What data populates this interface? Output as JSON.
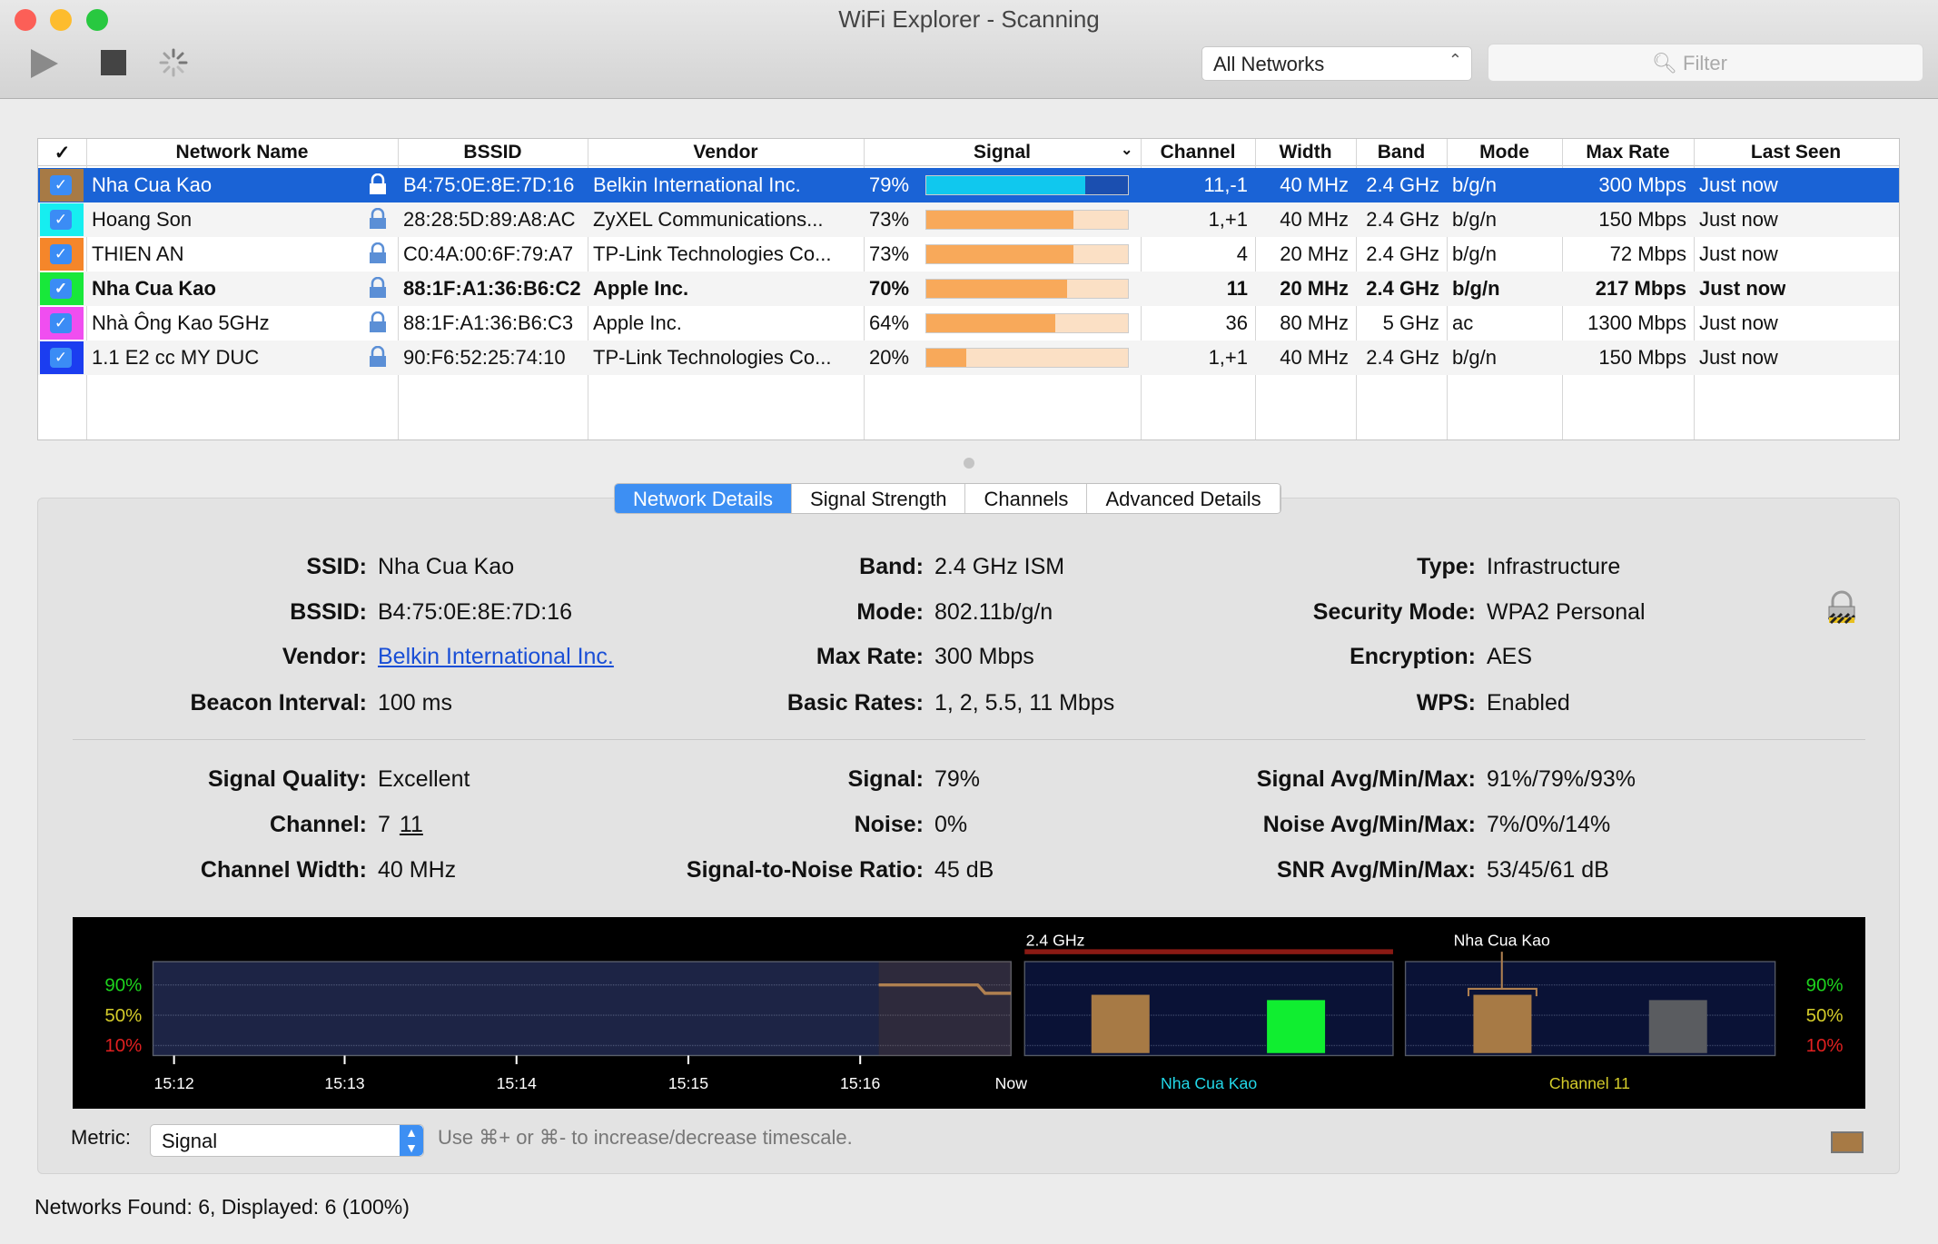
{
  "window": {
    "title": "WiFi Explorer - Scanning"
  },
  "toolbar": {
    "play": "play-icon",
    "stop": "stop-icon",
    "spinner": "spinner-icon",
    "network_filter": "All Networks",
    "filter_placeholder": "Filter"
  },
  "table": {
    "columns": [
      "✓",
      "Network Name",
      "BSSID",
      "Vendor",
      "Signal",
      "Channel",
      "Width",
      "Band",
      "Mode",
      "Max Rate",
      "Last Seen"
    ],
    "sort_column": "Signal",
    "rows": [
      {
        "color": "#a77a45",
        "checked": true,
        "name": "Nha Cua Kao",
        "bssid": "B4:75:0E:8E:7D:16",
        "vendor": "Belkin International Inc.",
        "signal": 79,
        "channel": "11,-1",
        "width": "40 MHz",
        "band": "2.4 GHz",
        "mode": "b/g/n",
        "max_rate": "300 Mbps",
        "last_seen": "Just now",
        "selected": true,
        "bold": false
      },
      {
        "color": "#16eef0",
        "checked": true,
        "name": "Hoang Son",
        "bssid": "28:28:5D:89:A8:AC",
        "vendor": "ZyXEL Communications...",
        "signal": 73,
        "channel": "1,+1",
        "width": "40 MHz",
        "band": "2.4 GHz",
        "mode": "b/g/n",
        "max_rate": "150 Mbps",
        "last_seen": "Just now",
        "selected": false,
        "bold": false
      },
      {
        "color": "#f5862a",
        "checked": true,
        "name": "THIEN AN",
        "bssid": "C0:4A:00:6F:79:A7",
        "vendor": "TP-Link Technologies Co...",
        "signal": 73,
        "channel": "4",
        "width": "20 MHz",
        "band": "2.4 GHz",
        "mode": "b/g/n",
        "max_rate": "72 Mbps",
        "last_seen": "Just now",
        "selected": false,
        "bold": false
      },
      {
        "color": "#18e83a",
        "checked": true,
        "name": "Nha Cua Kao",
        "bssid": "88:1F:A1:36:B6:C2",
        "vendor": "Apple Inc.",
        "signal": 70,
        "channel": "11",
        "width": "20 MHz",
        "band": "2.4 GHz",
        "mode": "b/g/n",
        "max_rate": "217 Mbps",
        "last_seen": "Just now",
        "selected": false,
        "bold": true
      },
      {
        "color": "#f04ef0",
        "checked": true,
        "name": "Nhà Ông Kao 5GHz",
        "bssid": "88:1F:A1:36:B6:C3",
        "vendor": "Apple Inc.",
        "signal": 64,
        "channel": "36",
        "width": "80 MHz",
        "band": "5 GHz",
        "mode": "ac",
        "max_rate": "1300 Mbps",
        "last_seen": "Just now",
        "selected": false,
        "bold": false
      },
      {
        "color": "#1b3df0",
        "checked": true,
        "name": "1.1 E2 cc MY DUC",
        "bssid": "90:F6:52:25:74:10",
        "vendor": "TP-Link Technologies Co...",
        "signal": 20,
        "channel": "1,+1",
        "width": "40 MHz",
        "band": "2.4 GHz",
        "mode": "b/g/n",
        "max_rate": "150 Mbps",
        "last_seen": "Just now",
        "selected": false,
        "bold": false
      }
    ]
  },
  "tabs": [
    {
      "label": "Network Details",
      "active": true
    },
    {
      "label": "Signal Strength",
      "active": false
    },
    {
      "label": "Channels",
      "active": false
    },
    {
      "label": "Advanced Details",
      "active": false
    }
  ],
  "details": {
    "col1": [
      {
        "label": "SSID:",
        "value": "Nha Cua Kao"
      },
      {
        "label": "BSSID:",
        "value": "B4:75:0E:8E:7D:16"
      },
      {
        "label": "Vendor:",
        "value": "Belkin International Inc.",
        "link": true
      },
      {
        "label": "Beacon Interval:",
        "value": "100 ms"
      }
    ],
    "col2": [
      {
        "label": "Band:",
        "value": "2.4 GHz ISM"
      },
      {
        "label": "Mode:",
        "value": "802.11b/g/n"
      },
      {
        "label": "Max Rate:",
        "value": "300 Mbps"
      },
      {
        "label": "Basic Rates:",
        "value": "1, 2, 5.5, 11 Mbps"
      }
    ],
    "col3": [
      {
        "label": "Type:",
        "value": "Infrastructure"
      },
      {
        "label": "Security Mode:",
        "value": "WPA2 Personal"
      },
      {
        "label": "Encryption:",
        "value": "AES"
      },
      {
        "label": "WPS:",
        "value": "Enabled"
      }
    ],
    "col4": [
      {
        "label": "Signal Quality:",
        "value": "Excellent"
      },
      {
        "label": "Channel:",
        "value": "7",
        "value2": "11"
      },
      {
        "label": "Channel Width:",
        "value": "40 MHz"
      }
    ],
    "col5": [
      {
        "label": "Signal:",
        "value": "79%"
      },
      {
        "label": "Noise:",
        "value": "0%"
      },
      {
        "label": "Signal-to-Noise Ratio:",
        "value": "45 dB"
      }
    ],
    "col6": [
      {
        "label": "Signal Avg/Min/Max:",
        "value": "91%/79%/93%"
      },
      {
        "label": "Noise Avg/Min/Max:",
        "value": "7%/0%/14%"
      },
      {
        "label": "SNR Avg/Min/Max:",
        "value": "53/45/61 dB"
      }
    ],
    "lock_icon": "padlock-icon"
  },
  "chart_data": {
    "type": "line",
    "y_ticks": [
      "90%",
      "50%",
      "10%"
    ],
    "y_tick_values": [
      90,
      50,
      10
    ],
    "y_tick_colors": [
      "#1ed41e",
      "#d4cc2a",
      "#e02020"
    ],
    "ylim": [
      0,
      100
    ],
    "x_ticks": [
      "15:12",
      "15:13",
      "15:14",
      "15:15",
      "15:16",
      "Now"
    ],
    "time_series": {
      "x": [
        "15:16",
        "15:16:25",
        "15:16:30",
        "15:16:45"
      ],
      "values": [
        90,
        90,
        79,
        79
      ],
      "color": "#b08050"
    },
    "band_panel": {
      "title": "2.4 GHz",
      "label": "Nha Cua Kao",
      "label_color": "#22d8e8",
      "bars": [
        {
          "value": 77,
          "color": "#a77a45"
        },
        {
          "value": 70,
          "color": "#10ee30"
        }
      ]
    },
    "channel_panel": {
      "title": "Nha Cua Kao",
      "label": "Channel 11",
      "label_color": "#d4cc2a",
      "bars": [
        {
          "value": 77,
          "color": "#a77a45"
        },
        {
          "value": 70,
          "color": "#5a5c60"
        }
      ]
    }
  },
  "metric": {
    "label": "Metric:",
    "value": "Signal",
    "hint": "Use ⌘+ or ⌘- to increase/decrease timescale.",
    "color_swatch": "#a77a45"
  },
  "status": "Networks Found: 6, Displayed: 6 (100%)"
}
